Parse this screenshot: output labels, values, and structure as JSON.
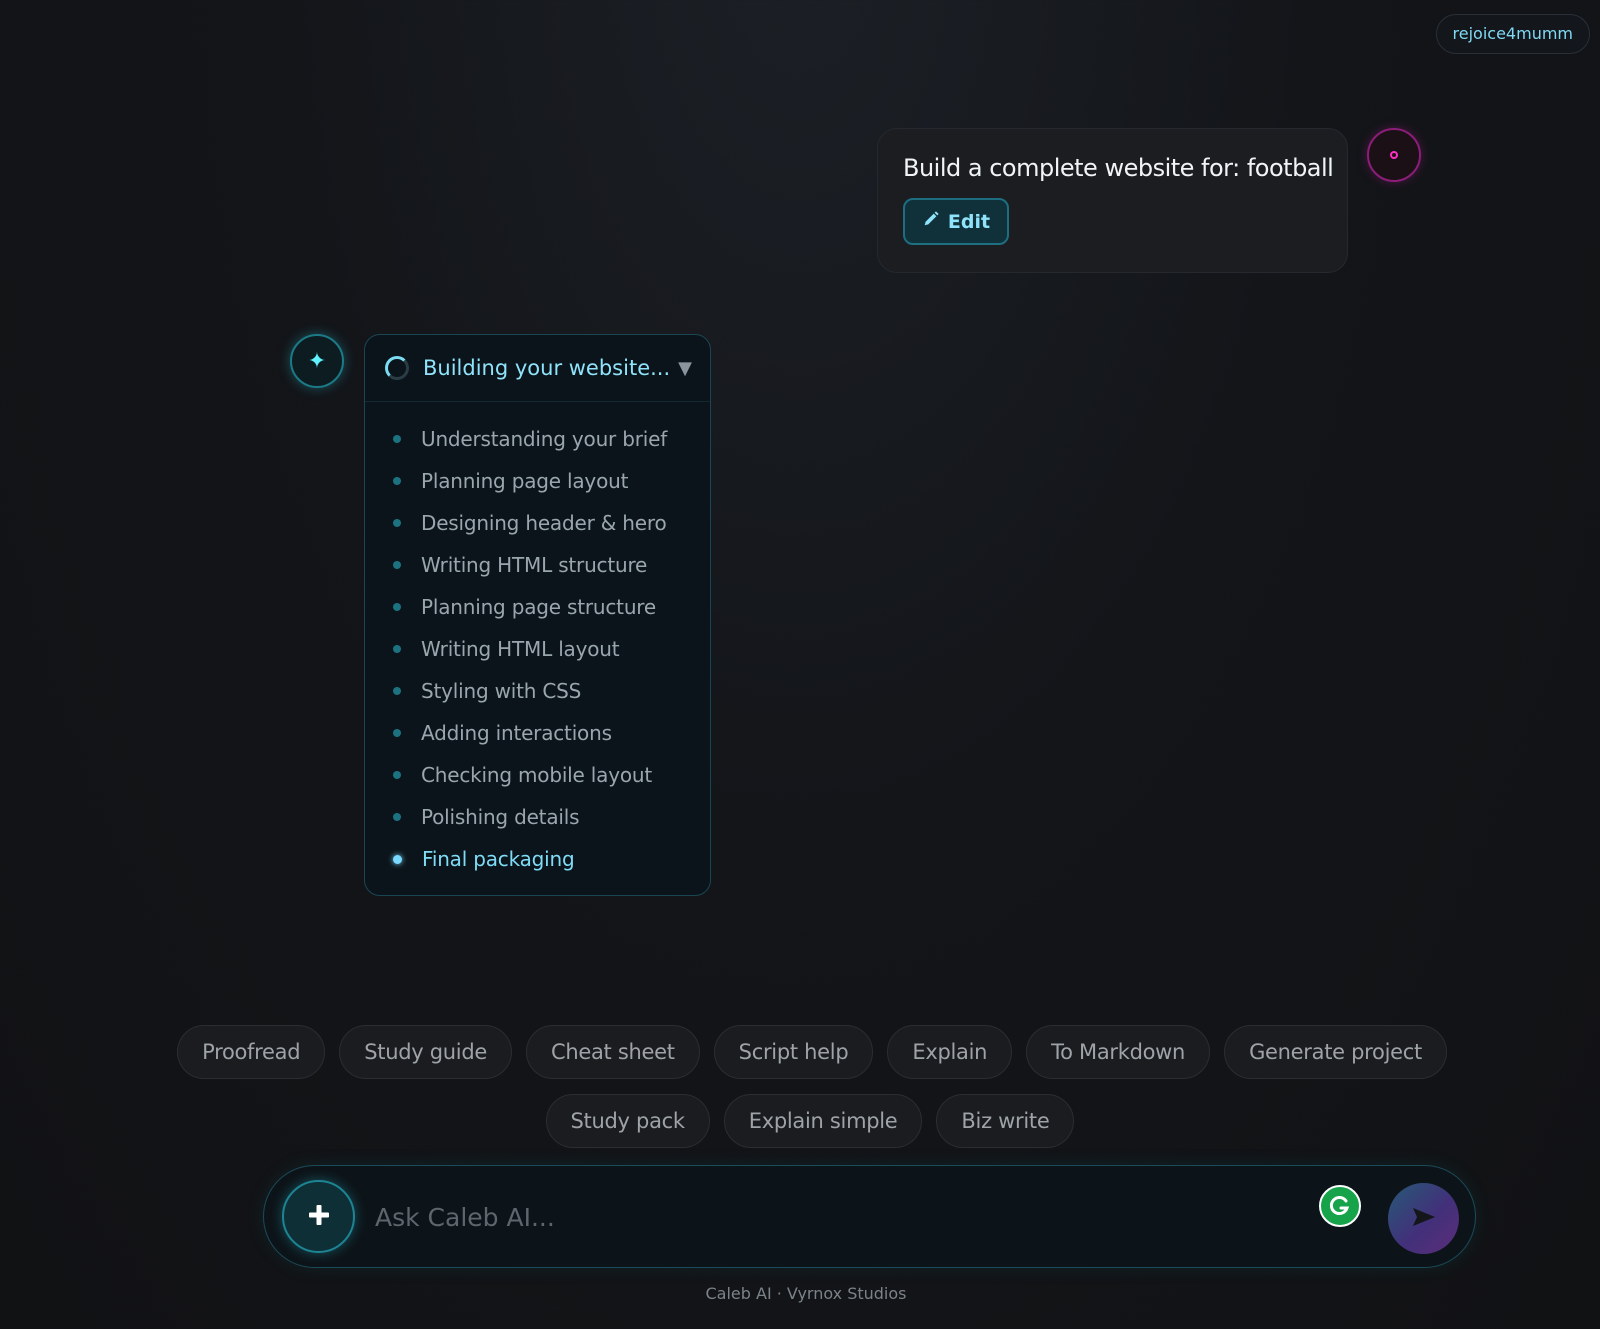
{
  "header": {
    "username": "rejoice4mumm"
  },
  "user_message": {
    "text": "Build a complete website for: football",
    "edit_label": "Edit"
  },
  "progress": {
    "title": "Building your website...",
    "steps": [
      "Understanding your brief",
      "Planning page layout",
      "Designing header & hero",
      "Writing HTML structure",
      "Planning page structure",
      "Writing HTML layout",
      "Styling with CSS",
      "Adding interactions",
      "Checking mobile layout",
      "Polishing details",
      "Final packaging"
    ],
    "active_step": 10
  },
  "quick_actions": {
    "row1": [
      "Proofread",
      "Study guide",
      "Cheat sheet",
      "Script help",
      "Explain",
      "To Markdown",
      "Generate project"
    ],
    "row2": [
      "Study pack",
      "Explain simple",
      "Biz write"
    ]
  },
  "composer": {
    "placeholder": "Ask Caleb AI..."
  },
  "footer": {
    "text": "Caleb AI · Vyrnox Studios"
  },
  "icons": {
    "edit": "pencil-icon",
    "assistant": "sparkle-icon",
    "attach": "plus-icon",
    "send": "send-arrow-icon",
    "grammar": "grammarly-icon"
  },
  "colors": {
    "accent": "#7fdcf7",
    "user_accent": "#ff2fc6"
  }
}
